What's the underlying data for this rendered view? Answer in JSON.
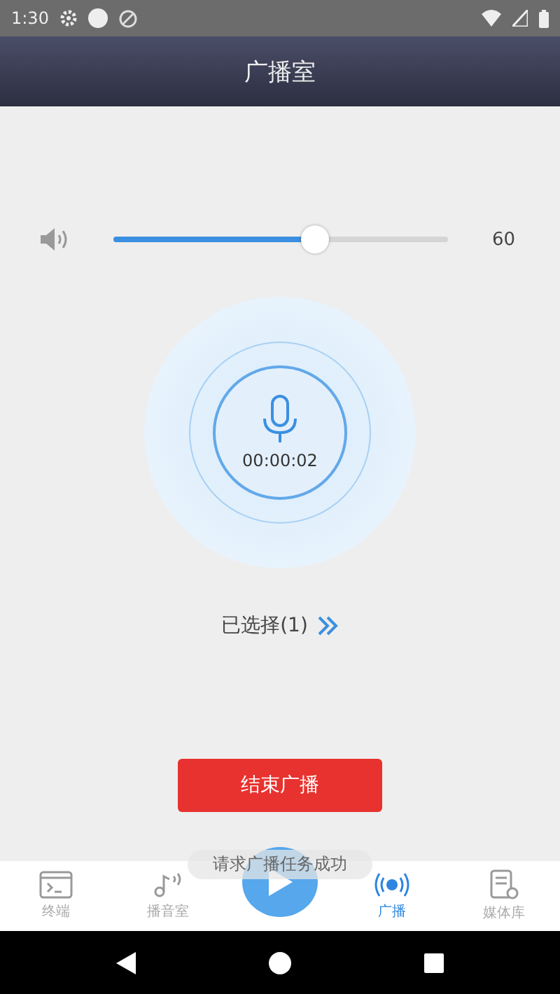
{
  "status_bar": {
    "time": "1:30"
  },
  "title_bar": {
    "title": "广播室"
  },
  "volume": {
    "level": 0.6,
    "reading": "60"
  },
  "recorder": {
    "timer": "00:00:02"
  },
  "selection": {
    "label": "已选择(1)"
  },
  "stop_button": {
    "label": "结束广播"
  },
  "toast": {
    "message": "请求广播任务成功"
  },
  "bottom_nav": [
    {
      "kind": "terminal",
      "label": "终端",
      "selected": false
    },
    {
      "kind": "studio",
      "label": "播音室",
      "selected": false
    },
    {
      "kind": "play"
    },
    {
      "kind": "broadcast",
      "label": "广播",
      "selected": true
    },
    {
      "kind": "library",
      "label": "媒体库",
      "selected": false
    }
  ]
}
